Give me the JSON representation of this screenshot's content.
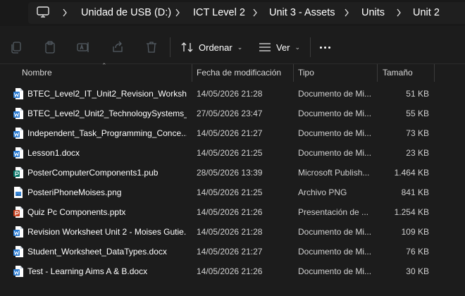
{
  "breadcrumb": {
    "items": [
      "Unidad de USB (D:)",
      "ICT Level 2",
      "Unit 3 - Assets",
      "Units",
      "Unit 2"
    ]
  },
  "toolbar": {
    "sort_label": "Ordenar",
    "view_label": "Ver"
  },
  "columns": {
    "name": "Nombre",
    "date": "Fecha de modificación",
    "type": "Tipo",
    "size": "Tamaño"
  },
  "files": [
    {
      "name": "BTEC_Level2_IT_Unit2_Revision_Workshe...",
      "date": "14/05/2026 21:28",
      "type": "Documento de Mi...",
      "size": "51 KB",
      "icon": "word-icon"
    },
    {
      "name": "BTEC_Level2_Unit2_TechnologySystems_...",
      "date": "27/05/2026 23:47",
      "type": "Documento de Mi...",
      "size": "55 KB",
      "icon": "word-icon"
    },
    {
      "name": "Independent_Task_Programming_Conce...",
      "date": "14/05/2026 21:27",
      "type": "Documento de Mi...",
      "size": "73 KB",
      "icon": "word-icon"
    },
    {
      "name": "Lesson1.docx",
      "date": "14/05/2026 21:25",
      "type": "Documento de Mi...",
      "size": "23 KB",
      "icon": "word-icon"
    },
    {
      "name": "PosterComputerComponents1.pub",
      "date": "28/05/2026 13:39",
      "type": "Microsoft Publish...",
      "size": "1.464 KB",
      "icon": "publisher-icon"
    },
    {
      "name": "PosteriPhoneMoises.png",
      "date": "14/05/2026 21:25",
      "type": "Archivo PNG",
      "size": "841 KB",
      "icon": "image-icon"
    },
    {
      "name": "Quiz Pc Components.pptx",
      "date": "14/05/2026 21:26",
      "type": "Presentación de ...",
      "size": "1.254 KB",
      "icon": "powerpoint-icon"
    },
    {
      "name": "Revision Worksheet Unit 2 - Moises Gutie...",
      "date": "14/05/2026 21:28",
      "type": "Documento de Mi...",
      "size": "109 KB",
      "icon": "word-icon"
    },
    {
      "name": "Student_Worksheet_DataTypes.docx",
      "date": "14/05/2026 21:27",
      "type": "Documento de Mi...",
      "size": "76 KB",
      "icon": "word-icon"
    },
    {
      "name": "Test - Learning Aims A & B.docx",
      "date": "14/05/2026 21:26",
      "type": "Documento de Mi...",
      "size": "30 KB",
      "icon": "word-icon"
    }
  ],
  "colors": {
    "background": "#1c1c1c",
    "word": "#2b7cd3",
    "publisher": "#077568",
    "powerpoint": "#c43e1c",
    "image": "#3a87d6"
  }
}
